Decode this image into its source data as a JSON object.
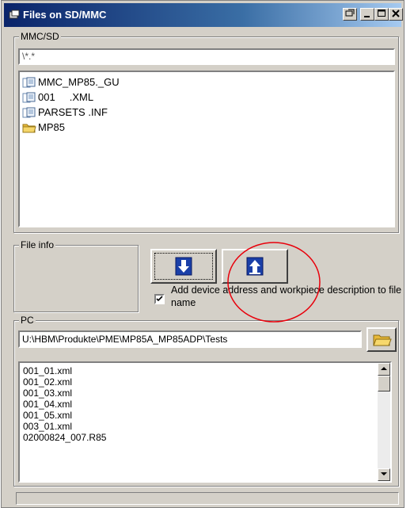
{
  "window": {
    "title": "Files on SD/MMC"
  },
  "mmc": {
    "group_label": "MMC/SD",
    "path": "\\*.*",
    "items": [
      {
        "name": "MMC_MP85._GU",
        "icon": "file-icon"
      },
      {
        "name": "001     .XML",
        "icon": "file-icon"
      },
      {
        "name": "PARSETS .INF",
        "icon": "file-icon"
      },
      {
        "name": "MP85",
        "icon": "folder-icon"
      }
    ]
  },
  "file_info": {
    "group_label": "File info"
  },
  "transfer": {
    "checkbox_label_line1": "Add device address and workpiece description to file",
    "checkbox_label_line2": "name",
    "checked": true
  },
  "pc": {
    "group_label": "PC",
    "path": "U:\\HBM\\Produkte\\PME\\MP85A_MP85ADP\\Tests",
    "files": [
      "001_01.xml",
      "001_02.xml",
      "001_03.xml",
      "001_04.xml",
      "001_05.xml",
      "003_01.xml",
      "02000824_007.R85"
    ]
  },
  "annotation_color": "#e8000b"
}
